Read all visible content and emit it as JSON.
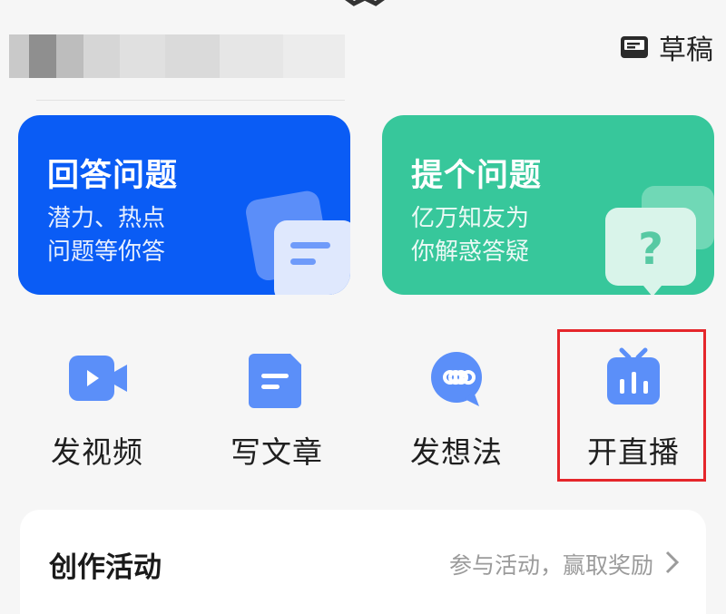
{
  "header": {
    "drafts_label": "草稿",
    "drafts_icon": "drafts-tray-icon",
    "username_obscured": true
  },
  "cards": [
    {
      "title": "回答问题",
      "subtitle_line1": "潜力、热点",
      "subtitle_line2": "问题等你答",
      "color": "#0a5cf5",
      "icon": "answer-document-icon"
    },
    {
      "title": "提个问题",
      "subtitle_line1": "亿万知友为",
      "subtitle_line2": "你解惑答疑",
      "color": "#37c79b",
      "icon": "question-bubble-icon"
    }
  ],
  "actions": [
    {
      "label": "发视频",
      "icon": "video-camera-icon"
    },
    {
      "label": "写文章",
      "icon": "article-icon"
    },
    {
      "label": "发想法",
      "icon": "idea-bubble-icon"
    },
    {
      "label": "开直播",
      "icon": "live-tv-icon",
      "highlighted": true
    }
  ],
  "activity": {
    "title": "创作活动",
    "subtitle": "参与活动，赢取奖励",
    "chevron_icon": "chevron-right-icon"
  },
  "colors": {
    "icon_blue": "#5b8ff9",
    "highlight_red": "#e5262b"
  }
}
